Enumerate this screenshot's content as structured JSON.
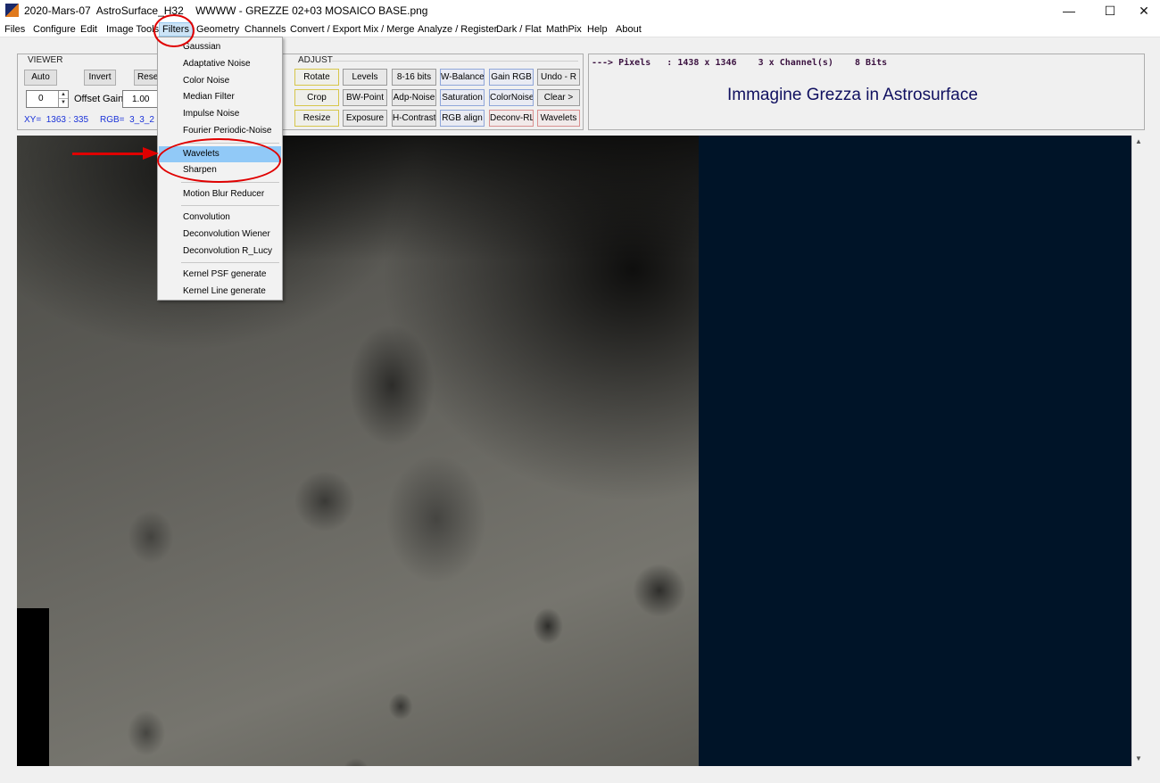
{
  "window": {
    "title": "2020-Mars-07  AstroSurface_H32    WWWW - GREZZE 02+03 MOSAICO BASE.png",
    "controls": {
      "minimize": "—",
      "maximize": "☐",
      "close": "✕"
    }
  },
  "menu": {
    "files": "Files",
    "configure": "Configure",
    "edit": "Edit",
    "image_tools": "Image Tools",
    "filters": "Filters",
    "geometry": "Geometry",
    "channels": "Channels",
    "convert_export": "Convert / Export",
    "mix_merge": "Mix / Merge",
    "analyze_register": "Analyze / Register",
    "dark_flat": "Dark / Flat",
    "mathpix": "MathPix",
    "help": "Help",
    "about": "About"
  },
  "viewer": {
    "caption": "VIEWER",
    "auto": "Auto",
    "invert": "Invert",
    "reset": "Reset",
    "offset_value": "0",
    "offset_label": "Offset",
    "gain_label": "Gain",
    "gain_value": "1.00",
    "xy_readout": "XY=  1363 : 335",
    "rgb_readout": "RGB=  3_3_2"
  },
  "adjust": {
    "caption": "ADJUST",
    "buttons": {
      "rotate": "Rotate",
      "levels": "Levels",
      "bits": "8-16 bits",
      "w_balance": "W-Balance",
      "gain_rgb": "Gain RGB",
      "undo": "Undo - R",
      "crop": "Crop",
      "bw_point": "BW-Point",
      "adp_noise": "Adp-Noise",
      "saturation": "Saturation",
      "color_noise": "ColorNoise",
      "clear": "Clear >",
      "resize": "Resize",
      "exposure": "Exposure",
      "h_contrast": "H-Contrast",
      "rgb_align": "RGB align",
      "deconv_rl": "Deconv-RL",
      "wavelets": "Wavelets"
    }
  },
  "info": {
    "pixels_line": "---> Pixels   : 1438 x 1346    3 x Channel(s)    8 Bits",
    "image_title": "Immagine Grezza in Astrosurface"
  },
  "filters_menu": {
    "items": [
      "Gaussian",
      "Adaptative Noise",
      "Color Noise",
      "Median Filter",
      "Impulse Noise",
      "Fourier Periodic-Noise",
      "Wavelets",
      "Sharpen",
      "Motion Blur Reducer",
      "Convolution",
      "Deconvolution Wiener",
      "Deconvolution R_Lucy",
      "Kernel PSF generate",
      "Kernel Line generate"
    ],
    "highlighted": "Wavelets"
  },
  "scrollbar": {
    "up": "▲",
    "down": "▼"
  },
  "colors": {
    "annotation": "#e00000",
    "menu_highlight": "#91c9f7",
    "viewport_bg": "#001428",
    "title_text": "#101060",
    "readout_text": "#1a32d8"
  }
}
